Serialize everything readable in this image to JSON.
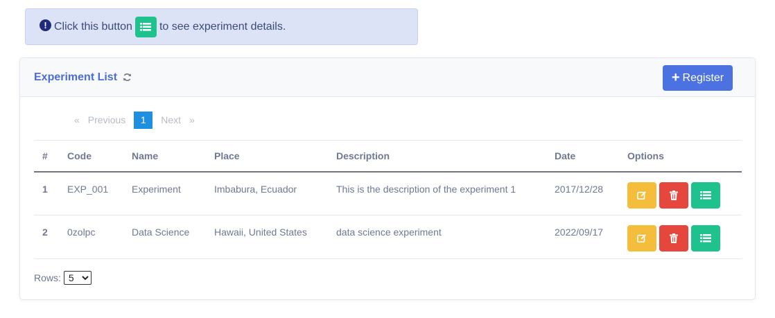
{
  "alert": {
    "text_before": "Click this button",
    "text_after": "to see experiment details."
  },
  "card": {
    "title": "Experiment List",
    "register_label": "Register"
  },
  "pagination": {
    "first": "«",
    "previous": "Previous",
    "current": "1",
    "next": "Next",
    "last": "»"
  },
  "table": {
    "headers": [
      "#",
      "Code",
      "Name",
      "Place",
      "Description",
      "Date",
      "Options"
    ],
    "rows": [
      [
        "1",
        "EXP_001",
        "Experiment",
        "Imbabura, Ecuador",
        "This is the description of the experiment 1",
        "2017/12/28"
      ],
      [
        "2",
        "0zolpc",
        "Data Science",
        "Hawaii, United States",
        "data science experiment",
        "2022/09/17"
      ]
    ]
  },
  "footer": {
    "rows_label": "Rows:",
    "rows_selected": "5"
  },
  "icons": {
    "alert": "exclamation-circle-icon",
    "details": "list-icon",
    "refresh": "refresh-icon",
    "edit": "edit-icon",
    "delete": "trash-icon",
    "add": "plus-icon"
  },
  "colors": {
    "primary": "#4b72e0",
    "title": "#4b6bd8",
    "edit": "#f4bd3b",
    "delete": "#e5473c",
    "details": "#1fc28c",
    "page_active": "#1f8fe0",
    "alert_bg": "#dde3f6"
  }
}
